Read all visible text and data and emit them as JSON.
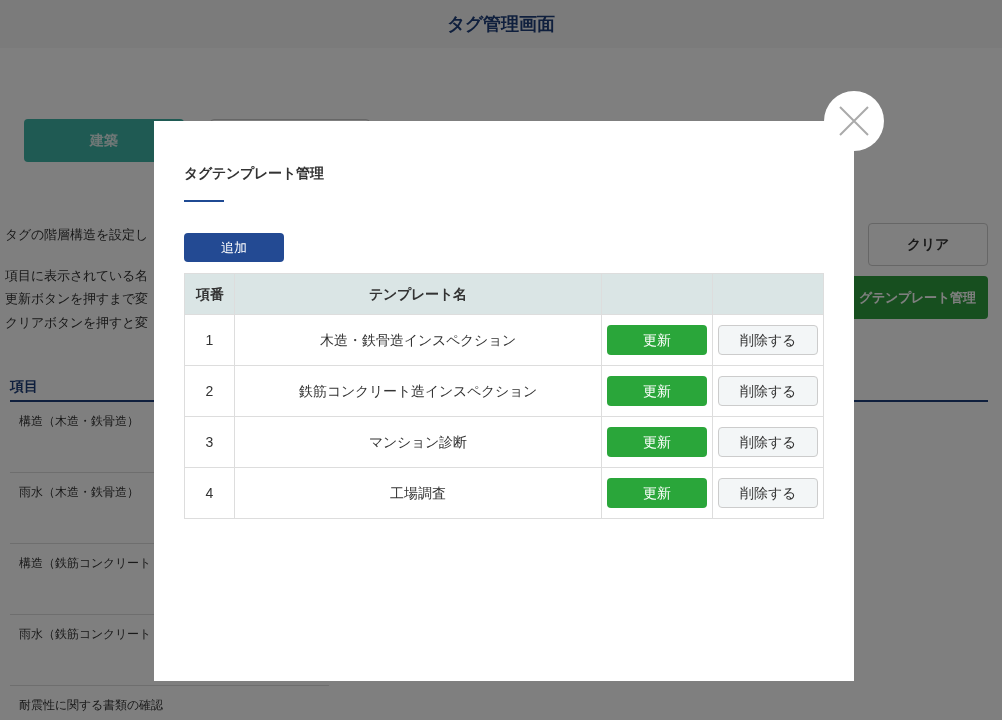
{
  "header": {
    "title": "タグ管理画面"
  },
  "tabs": [
    {
      "label": "建築",
      "selected": true
    },
    {
      "selected": false
    }
  ],
  "notes": [
    "タグの階層構造を設定し",
    "項目に表示されている名",
    "更新ボタンを押すまで変",
    "クリアボタンを押すと変"
  ],
  "actions": {
    "clear": "クリア",
    "templates": "グテンプレート管理"
  },
  "items": {
    "heading": "項目",
    "rows": [
      "構造（木造・鉄骨造）",
      "雨水（木造・鉄骨造）",
      "構造（鉄筋コンクリート",
      "雨水（鉄筋コンクリート",
      "耐震性に関する書類の確認"
    ]
  },
  "modal": {
    "title": "タグテンプレート管理",
    "add": "追加",
    "columns": [
      "項番",
      "テンプレート名"
    ],
    "rows": [
      {
        "no": "1",
        "name": "木造・鉄骨造インスペクション",
        "update": "更新",
        "delete": "削除する"
      },
      {
        "no": "2",
        "name": "鉄筋コンクリート造インスペクション",
        "update": "更新",
        "delete": "削除する"
      },
      {
        "no": "3",
        "name": "マンション診断",
        "update": "更新",
        "delete": "削除する"
      },
      {
        "no": "4",
        "name": "工場調査",
        "update": "更新",
        "delete": "削除する"
      }
    ]
  }
}
